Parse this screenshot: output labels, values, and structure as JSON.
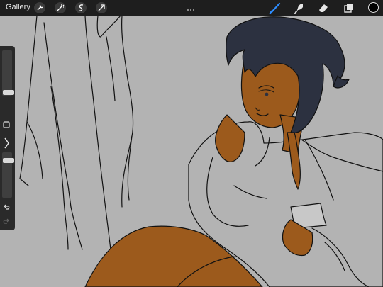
{
  "topbar": {
    "gallery_label": "Gallery",
    "left_tools": [
      "wrench-icon",
      "magic-wand-icon",
      "selection-icon",
      "transform-arrow-icon"
    ],
    "right_tools": [
      "brush-icon",
      "smudge-icon",
      "eraser-icon",
      "layers-icon"
    ],
    "active_tool": "brush-icon",
    "accent_color": "#2d8cff",
    "current_color": "#000000"
  },
  "sidebar": {
    "brush_size_level": 0.55,
    "opacity_level": 0.7,
    "buttons": [
      "modify-square-icon",
      "undo-icon",
      "redo-icon"
    ]
  },
  "canvas": {
    "background_color": "#b3b3b3",
    "line_color": "#111111",
    "skin_color": "#9c5a1c",
    "hair_color": "#2c3140"
  }
}
